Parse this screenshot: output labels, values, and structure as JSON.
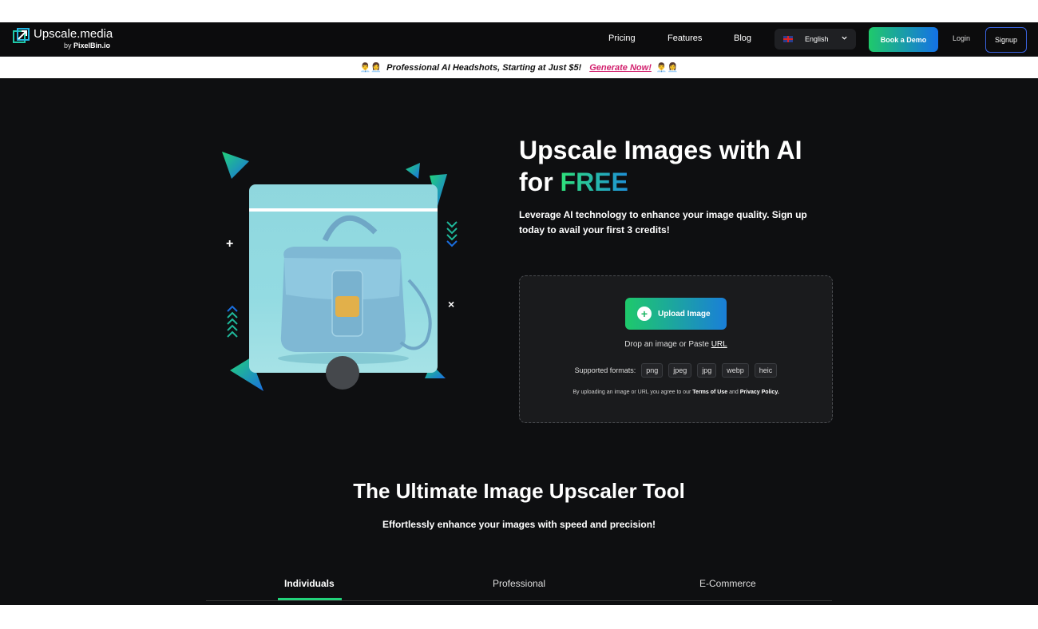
{
  "header": {
    "logo_name": "Upscale.media",
    "logo_by": "by",
    "logo_by_brand": "PixelBin.io",
    "nav": [
      "Pricing",
      "Features",
      "Blog"
    ],
    "language": "English",
    "book_demo": "Book a Demo",
    "login": "Login",
    "signup": "Signup"
  },
  "promo": {
    "emoji": "👨‍💼👩‍💼",
    "text": "Professional AI Headshots, Starting at Just $5!",
    "cta": "Generate Now!"
  },
  "hero": {
    "title_line1": "Upscale Images with AI",
    "title_for": "for",
    "title_free": "FREE",
    "subtitle": "Leverage AI technology to enhance your image quality. Sign up today to avail your first 3 credits!"
  },
  "upload": {
    "button": "Upload Image",
    "drop_text": "Drop an image or Paste",
    "url_link": "URL",
    "formats_label": "Supported formats:",
    "formats": [
      "png",
      "jpeg",
      "jpg",
      "webp",
      "heic"
    ],
    "terms_prefix": "By uploading an image or URL you agree to our",
    "terms_link": "Terms of Use",
    "terms_and": "and",
    "privacy_link": "Privacy Policy."
  },
  "section": {
    "title": "The Ultimate Image Upscaler Tool",
    "subtitle": "Effortlessly enhance your images with speed and precision!",
    "tabs": [
      "Individuals",
      "Professional",
      "E-Commerce"
    ],
    "active_tab": "Individuals"
  },
  "colors": {
    "background": "#0e0f11",
    "accent_green": "#1fc96b",
    "accent_blue": "#1471e6",
    "promo_link": "#d21f6d"
  }
}
